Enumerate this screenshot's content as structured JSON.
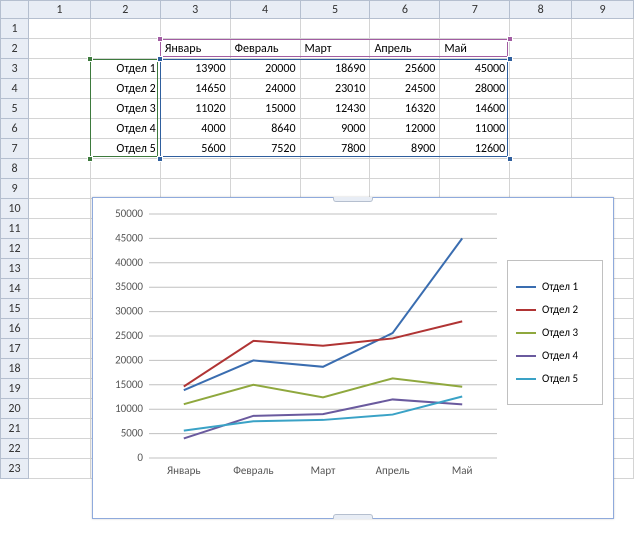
{
  "col_headers": [
    "1",
    "2",
    "3",
    "4",
    "5",
    "6",
    "7",
    "8",
    "9"
  ],
  "row_headers": [
    "1",
    "2",
    "3",
    "4",
    "5",
    "6",
    "7",
    "8",
    "9",
    "10",
    "11",
    "12",
    "13",
    "14",
    "15",
    "16",
    "17",
    "18",
    "19",
    "20",
    "21",
    "22",
    "23"
  ],
  "table": {
    "col_labels": [
      "Январь",
      "Февраль",
      "Март",
      "Апрель",
      "Май"
    ],
    "rows": [
      {
        "label": "Отдел 1",
        "vals": [
          "13900",
          "20000",
          "18690",
          "25600",
          "45000"
        ]
      },
      {
        "label": "Отдел 2",
        "vals": [
          "14650",
          "24000",
          "23010",
          "24500",
          "28000"
        ]
      },
      {
        "label": "Отдел 3",
        "vals": [
          "11020",
          "15000",
          "12430",
          "16320",
          "14600"
        ]
      },
      {
        "label": "Отдел 4",
        "vals": [
          "4000",
          "8640",
          "9000",
          "12000",
          "11000"
        ]
      },
      {
        "label": "Отдел 5",
        "vals": [
          "5600",
          "7520",
          "7800",
          "8900",
          "12600"
        ]
      }
    ]
  },
  "chart_data": {
    "type": "line",
    "categories": [
      "Январь",
      "Февраль",
      "Март",
      "Апрель",
      "Май"
    ],
    "series": [
      {
        "name": "Отдел 1",
        "values": [
          13900,
          20000,
          18690,
          25600,
          45000
        ],
        "color": "#3a6db0"
      },
      {
        "name": "Отдел 2",
        "values": [
          14650,
          24000,
          23010,
          24500,
          28000
        ],
        "color": "#b03434"
      },
      {
        "name": "Отдел 3",
        "values": [
          11020,
          15000,
          12430,
          16320,
          14600
        ],
        "color": "#8fa83e"
      },
      {
        "name": "Отдел 4",
        "values": [
          4000,
          8640,
          9000,
          12000,
          11000
        ],
        "color": "#6a5a9e"
      },
      {
        "name": "Отдел 5",
        "values": [
          5600,
          7520,
          7800,
          8900,
          12600
        ],
        "color": "#3aa2c6"
      }
    ],
    "ylim": [
      0,
      50000
    ],
    "ystep": 5000,
    "xlabel": "",
    "ylabel": "",
    "title": ""
  },
  "colors": {
    "sel_months": "#a25ca2",
    "sel_rows": "#3d7a3d",
    "sel_vals": "#2f5f9e"
  }
}
